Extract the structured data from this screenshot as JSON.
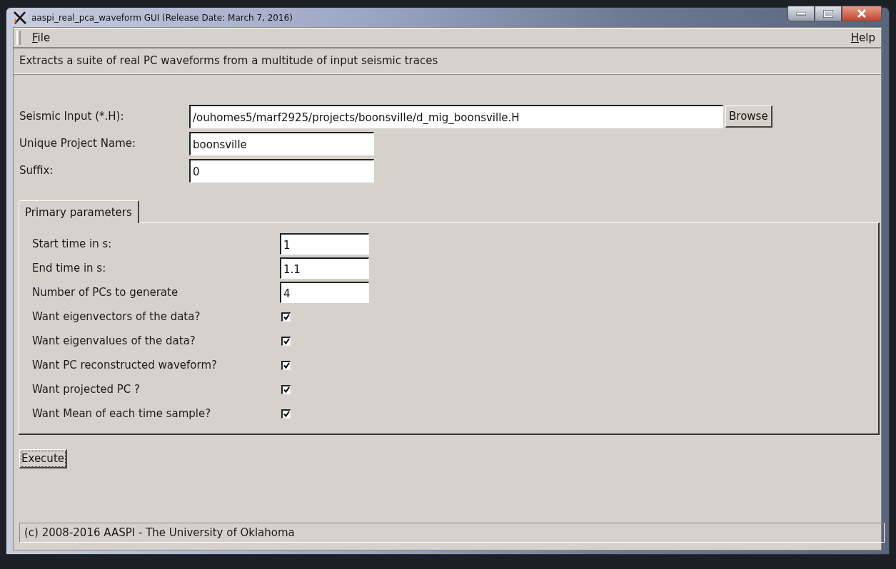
{
  "window": {
    "title": "aaspi_real_pca_waveform GUI (Release Date: March 7, 2016)"
  },
  "menu": [
    "File",
    "Help"
  ],
  "description": "Extracts a suite of real PC waveforms from a multitude of input seismic traces",
  "fields": [
    {
      "label": "Seismic Input (*.H):",
      "value": "/ouhomes5/marf2925/projects/boonsville/d_mig_boonsville.H",
      "kind": "file",
      "button": "Browse"
    },
    {
      "label": "Unique Project Name:",
      "value": "boonsville",
      "kind": "text"
    },
    {
      "label": "Suffix:",
      "value": "0",
      "kind": "text"
    }
  ],
  "tabs": [
    {
      "label": "Primary parameters",
      "selected": true
    }
  ],
  "parameters": [
    {
      "kind": "text",
      "label": "Start time in s:",
      "value": "1"
    },
    {
      "kind": "text",
      "label": "End time in s:",
      "value": "1.1"
    },
    {
      "kind": "text",
      "label": "Number of PCs to generate",
      "value": "4"
    },
    {
      "kind": "checkbox",
      "label": "Want eigenvectors of the data?",
      "checked": true
    },
    {
      "kind": "checkbox",
      "label": "Want eigenvalues of the data?",
      "checked": true
    },
    {
      "kind": "checkbox",
      "label": "Want PC reconstructed waveform?",
      "checked": true
    },
    {
      "kind": "checkbox",
      "label": "Want projected PC ?",
      "checked": true
    },
    {
      "kind": "checkbox",
      "label": "Want Mean of each time sample?",
      "checked": true
    }
  ],
  "execute_button": "Execute",
  "status_bar": "(c) 2008-2016 AASPI - The University of Oklahoma"
}
